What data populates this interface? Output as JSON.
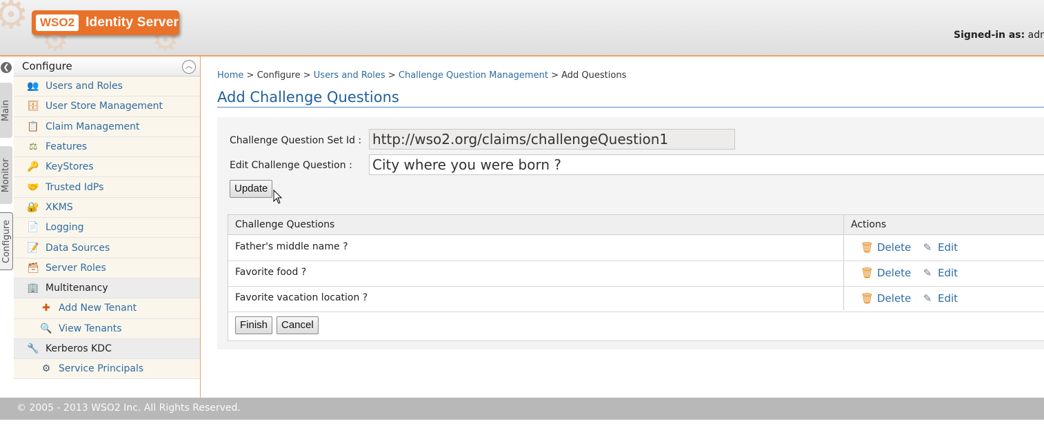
{
  "header": {
    "logo_brand": "WSO2",
    "logo_product": "Identity Server",
    "signed_in_label": "Signed-in as:",
    "signed_in_user": "adm"
  },
  "vtabs": {
    "collapse_icon": "chevron-left-icon",
    "items": [
      "Main",
      "Monitor",
      "Configure"
    ],
    "active": "Configure"
  },
  "sidebar": {
    "title": "Configure",
    "items": [
      {
        "label": "Users and Roles",
        "icon": "users-icon",
        "type": "link"
      },
      {
        "label": "User Store Management",
        "icon": "user-store-icon",
        "type": "link"
      },
      {
        "label": "Claim Management",
        "icon": "claim-icon",
        "type": "link"
      },
      {
        "label": "Features",
        "icon": "features-icon",
        "type": "link"
      },
      {
        "label": "KeyStores",
        "icon": "key-icon",
        "type": "link"
      },
      {
        "label": "Trusted IdPs",
        "icon": "handshake-icon",
        "type": "link"
      },
      {
        "label": "XKMS",
        "icon": "xkms-icon",
        "type": "link"
      },
      {
        "label": "Logging",
        "icon": "logging-icon",
        "type": "link"
      },
      {
        "label": "Data Sources",
        "icon": "data-sources-icon",
        "type": "link"
      },
      {
        "label": "Server Roles",
        "icon": "server-roles-icon",
        "type": "link"
      },
      {
        "label": "Multitenancy",
        "icon": "multitenancy-icon",
        "type": "group"
      },
      {
        "label": "Add New Tenant",
        "icon": "add-tenant-icon",
        "type": "sub"
      },
      {
        "label": "View Tenants",
        "icon": "view-tenants-icon",
        "type": "sub"
      },
      {
        "label": "Kerberos KDC",
        "icon": "kerberos-icon",
        "type": "group"
      },
      {
        "label": "Service Principals",
        "icon": "service-principals-icon",
        "type": "sub"
      }
    ]
  },
  "breadcrumb": {
    "home": "Home",
    "sep": ">",
    "configure": "Configure",
    "users_roles": "Users and Roles",
    "cqm": "Challenge Question Management",
    "current": "Add Questions"
  },
  "page_title": "Add Challenge Questions",
  "form": {
    "set_id_label": "Challenge Question Set Id :",
    "set_id_value": "http://wso2.org/claims/challengeQuestion1",
    "edit_label": "Edit Challenge Question :",
    "edit_value": "City where you were born ?",
    "update_button": "Update"
  },
  "table": {
    "col_questions": "Challenge Questions",
    "col_actions": "Actions",
    "delete_label": "Delete",
    "edit_label": "Edit",
    "rows": [
      {
        "question": "Father's middle name ?"
      },
      {
        "question": "Favorite food ?"
      },
      {
        "question": "Favorite vacation location ?"
      }
    ]
  },
  "buttons": {
    "finish": "Finish",
    "cancel": "Cancel"
  },
  "footer": {
    "copyright": "© 2005 - 2013 WSO2 Inc. All Rights Reserved."
  },
  "colors": {
    "brand_orange": "#e9722a",
    "link_blue": "#2c6ba3",
    "title_blue": "#1f5f99",
    "footer_gray": "#b8b8b8"
  }
}
